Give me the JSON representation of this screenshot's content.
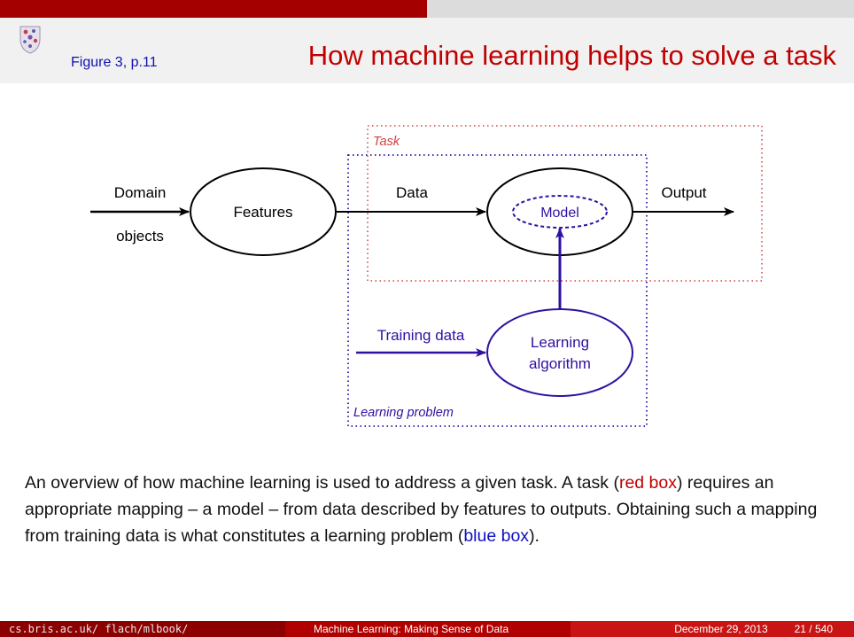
{
  "header": {
    "figure_ref": "Figure 3, p.11",
    "title": "How machine learning helps to solve a task"
  },
  "diagram": {
    "task_label": "Task",
    "learning_problem_label": "Learning problem",
    "domain_label": "Domain",
    "objects_label": "objects",
    "features_label": "Features",
    "data_label": "Data",
    "model_label": "Model",
    "output_label": "Output",
    "training_data_label": "Training data",
    "learning_label": "Learning",
    "algorithm_label": "algorithm",
    "colors": {
      "task_box": "#d04040",
      "learning_box": "#3010a0",
      "black": "#000000"
    }
  },
  "caption": {
    "part1": "An overview of how machine learning is used to address a given task. A task (",
    "red_box": "red box",
    "part2": ") requires an appropriate mapping – a model – from data described by features to outputs. Obtaining such a mapping from training data is what constitutes a learning problem (",
    "blue_box": "blue box",
    "part3": ")."
  },
  "footer": {
    "url": "cs.bris.ac.uk/ flach/mlbook/",
    "book": "Machine Learning: Making Sense of Data",
    "date": "December 29, 2013",
    "page": "21 / 540"
  }
}
